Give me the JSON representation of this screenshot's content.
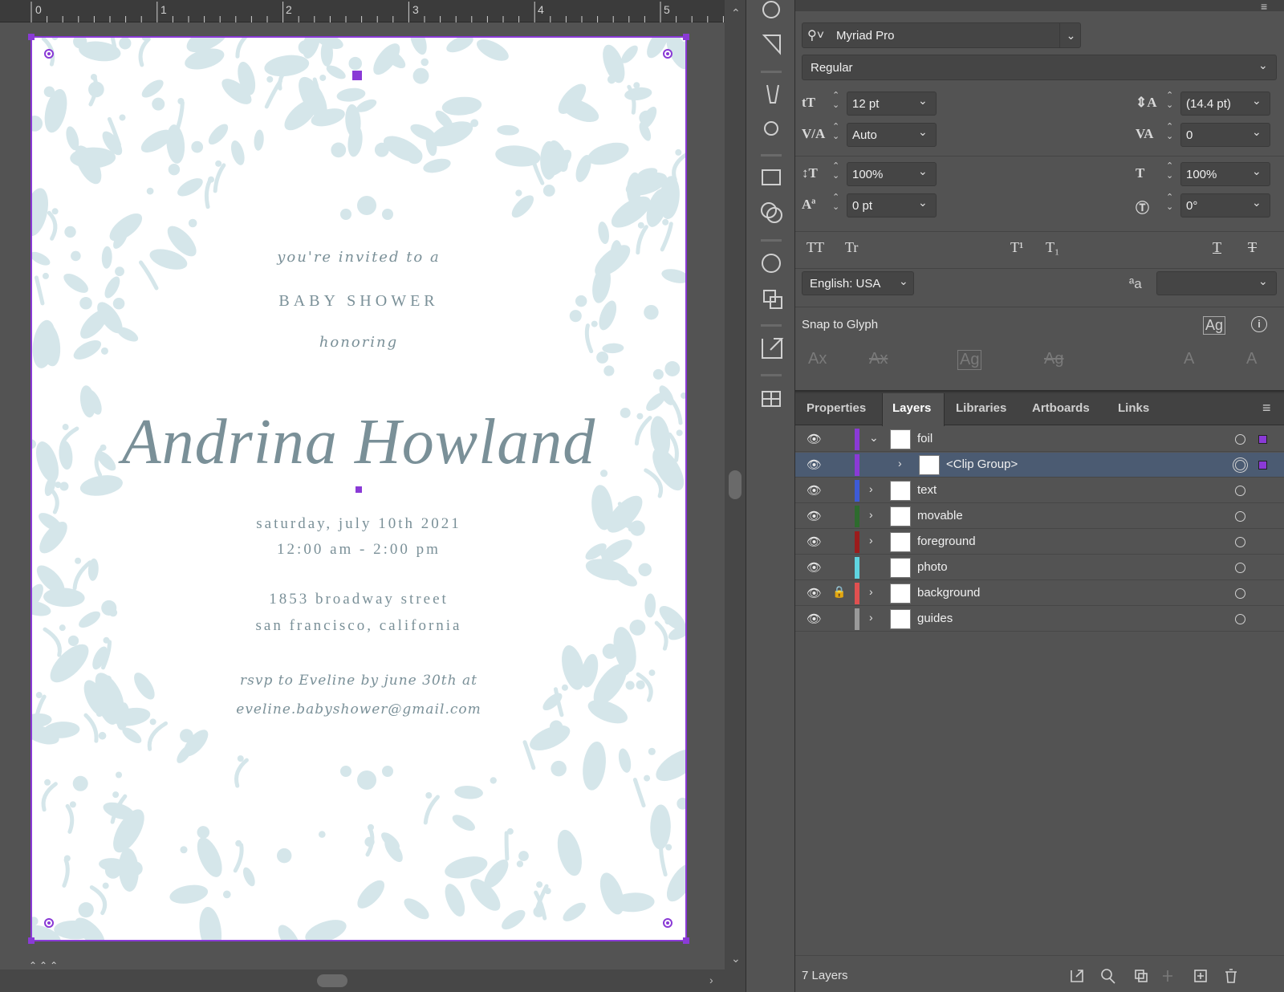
{
  "ruler": {
    "marks": [
      "0",
      "1",
      "2",
      "3",
      "4",
      "5"
    ]
  },
  "invite": {
    "line1": "you're invited to a",
    "line2": "BABY SHOWER",
    "line3": "honoring",
    "name": "Andrina Howland",
    "date": "saturday, july 10th 2021",
    "time": "12:00 am - 2:00 pm",
    "address1": "1853 broadway street",
    "address2": "san francisco, california",
    "rsvp": "rsvp to Eveline by june 30th at",
    "email": "eveline.babyshower@gmail.com"
  },
  "character": {
    "font_family": "Myriad Pro",
    "font_style": "Regular",
    "size": "12 pt",
    "leading": "(14.4 pt)",
    "kerning": "Auto",
    "tracking": "0",
    "vscale": "100%",
    "hscale": "100%",
    "baseline": "0 pt",
    "rotation": "0°",
    "language": "English: USA",
    "snap_label": "Snap to Glyph",
    "caps_all": "TT",
    "caps_small": "Tr",
    "super": "T¹",
    "sub": "T₁",
    "underline": "T",
    "strike": "T",
    "aa": "ªa",
    "snap_glyph": "Ag",
    "glyphs": [
      "Ax",
      "Ax",
      "Ag",
      "Ag",
      "A",
      "A"
    ]
  },
  "tabs": {
    "items": [
      "Properties",
      "Layers",
      "Libraries",
      "Artboards",
      "Links"
    ]
  },
  "layers": {
    "items": [
      {
        "name": "foil",
        "color": "#8a3ad6"
      },
      {
        "name": "<Clip Group>",
        "color": "#8a3ad6"
      },
      {
        "name": "text",
        "color": "#3d5bd6"
      },
      {
        "name": "movable",
        "color": "#2e6b2e"
      },
      {
        "name": "foreground",
        "color": "#9b1c1c"
      },
      {
        "name": "photo",
        "color": "#5fd4e0"
      },
      {
        "name": "background",
        "color": "#e05050"
      },
      {
        "name": "guides",
        "color": "#9a9a9a"
      }
    ],
    "count": "7 Layers"
  },
  "colors": {
    "foliage": "#d5e6ea",
    "ink": "#7a9098",
    "selection": "#8a3ad6",
    "panel": "#535353",
    "highlight": "#4b5b72"
  }
}
